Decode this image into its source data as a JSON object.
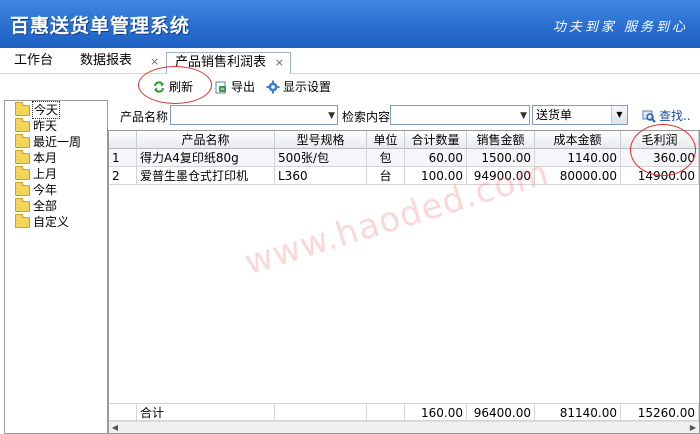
{
  "header": {
    "title": "百惠送货单管理系统",
    "slogan": "功夫到家 服务到心"
  },
  "tabs": [
    {
      "label": "工作台"
    },
    {
      "label": "数据报表"
    },
    {
      "label": "产品销售利润表"
    }
  ],
  "tab_close_glyph": "×",
  "toolbar": {
    "refresh": "刷新",
    "export": "导出",
    "display_settings": "显示设置"
  },
  "tree": {
    "items": [
      "今天",
      "昨天",
      "最近一周",
      "本月",
      "上月",
      "今年",
      "全部",
      "自定义"
    ],
    "selected": "今天"
  },
  "filter": {
    "product_name_label": "产品名称",
    "product_name_value": "",
    "search_content_label": "检索内容",
    "search_content_value": "",
    "doc_type_value": "送货单",
    "search_button": "查找.."
  },
  "grid": {
    "columns": [
      "",
      "产品名称",
      "型号规格",
      "单位",
      "合计数量",
      "销售金额",
      "成本金额",
      "毛利润"
    ],
    "rows": [
      {
        "no": "1",
        "name": "得力A4复印纸80g",
        "spec": "500张/包",
        "unit": "包",
        "qty": "60.00",
        "sales": "1500.00",
        "cost": "1140.00",
        "profit": "360.00"
      },
      {
        "no": "2",
        "name": "爱普生墨仓式打印机",
        "spec": "L360",
        "unit": "台",
        "qty": "100.00",
        "sales": "94900.00",
        "cost": "80000.00",
        "profit": "14900.00"
      }
    ],
    "footer": {
      "label": "合计",
      "qty": "160.00",
      "sales": "96400.00",
      "cost": "81140.00",
      "profit": "15260.00"
    }
  },
  "watermark": "www.haoded.com",
  "colors": {
    "header_bg": "#2a6fd0",
    "annotation": "#e03030",
    "watermark": "#f06e6e"
  }
}
